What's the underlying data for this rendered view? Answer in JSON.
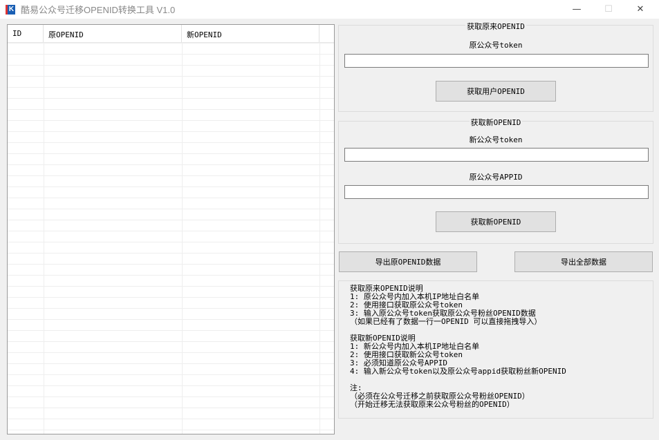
{
  "window": {
    "title": "酷易公众号迁移OPENID转换工具 V1.0",
    "logo": "K",
    "minimize": "—",
    "maximize": "☐",
    "close": "✕"
  },
  "table": {
    "columns": [
      "ID",
      "原OPENID",
      "新OPENID"
    ]
  },
  "group1": {
    "title": "获取原来OPENID",
    "token_label": "原公众号token",
    "token_value": "",
    "button": "获取用户OPENID"
  },
  "group2": {
    "title": "获取新OPENID",
    "token_label": "新公众号token",
    "token_value": "",
    "appid_label": "原公众号APPID",
    "appid_value": "",
    "button": "获取新OPENID"
  },
  "export": {
    "orig": "导出原OPENID数据",
    "all": "导出全部数据"
  },
  "notes": [
    "获取原来OPENID说明",
    "1: 原公众号内加入本机IP地址白名单",
    "2: 使用接口获取原公众号token",
    "3: 输入原公众号token获取原公众号粉丝OPENID数据",
    "（如果已经有了数据一行一OPENID 可以直接拖拽导入）",
    "",
    "获取新OPENID说明",
    "1: 新公众号内加入本机IP地址白名单",
    "2: 使用接口获取新公众号token",
    "3: 必须知道原公众号APPID",
    "4: 输入新公众号token以及原公众号appid获取粉丝新OPENID",
    "",
    "注:",
    "（必须在公众号迁移之前获取原公众号粉丝OPENID）",
    "（开始迁移无法获取原来公众号粉丝的OPENID）"
  ]
}
